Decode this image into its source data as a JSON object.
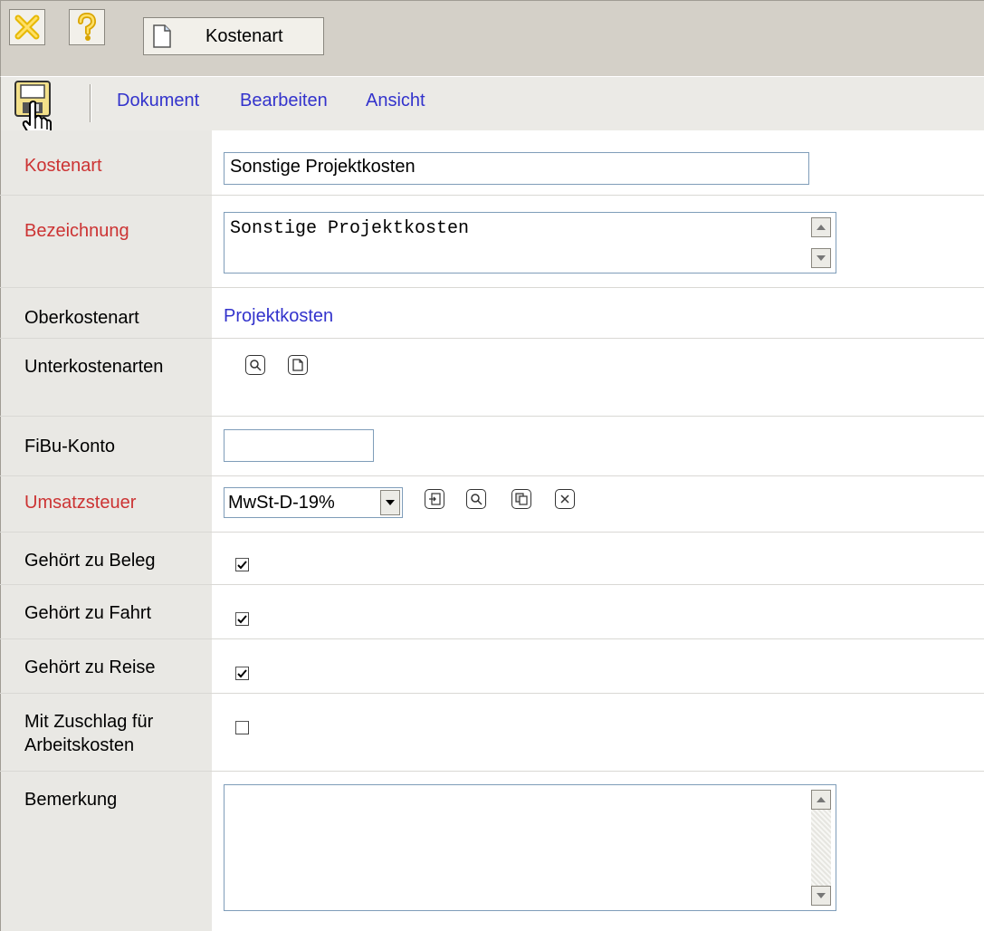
{
  "titlebar": {
    "close_icon": "close-x-icon",
    "help_icon": "help-question-icon",
    "tab": {
      "icon": "document-icon",
      "label": "Kostenart"
    }
  },
  "toolbar": {
    "save_icon": "save-disk-icon",
    "menu": [
      "Dokument",
      "Bearbeiten",
      "Ansicht"
    ]
  },
  "form": {
    "kostenart": {
      "label": "Kostenart",
      "value": "Sonstige Projektkosten"
    },
    "bezeichnung": {
      "label": "Bezeichnung",
      "value": "Sonstige Projektkosten"
    },
    "oberkostenart": {
      "label": "Oberkostenart",
      "value": "Projektkosten"
    },
    "unterkostenarten": {
      "label": "Unterkostenarten"
    },
    "fibu": {
      "label": "FiBu-Konto",
      "value": ""
    },
    "umsatzsteuer": {
      "label": "Umsatzsteuer",
      "value": "MwSt-D-19%"
    },
    "beleg": {
      "label": "Gehört zu Beleg",
      "checked": true
    },
    "fahrt": {
      "label": "Gehört zu Fahrt",
      "checked": true
    },
    "reise": {
      "label": "Gehört zu Reise",
      "checked": true
    },
    "zuschlag": {
      "label_line1": "Mit Zuschlag für",
      "label_line2": "Arbeitskosten",
      "checked": false
    },
    "bemerkung": {
      "label": "Bemerkung",
      "value": ""
    }
  },
  "colors": {
    "required_label": "#cc3333",
    "link": "#3333cc",
    "label_bg": "#e9e8e4",
    "chrome": "#d4d0c8"
  }
}
